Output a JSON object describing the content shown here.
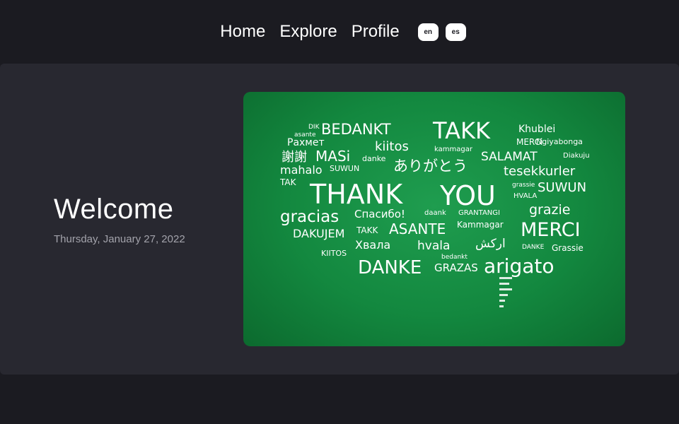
{
  "nav": {
    "links": [
      "Home",
      "Explore",
      "Profile"
    ],
    "languages": [
      "en",
      "es"
    ]
  },
  "main": {
    "title": "Welcome",
    "date": "Thursday, January 27, 2022"
  },
  "hero_image": {
    "alt": "Thank you word cloud on chalkboard",
    "background_color": "#13883f",
    "words": {
      "w1": "DIK",
      "w2": "BEDANKT",
      "w3": "TAKK",
      "w4": "Khublei",
      "w5": "asante",
      "w6": "Рахмет",
      "w7": "kiitos",
      "w8": "MERCi",
      "w9": "Ngiyabonga",
      "w10": "謝謝",
      "w11": "MASi",
      "w12": "kammagar",
      "w13": "SALAMAT",
      "w14": "Diakuju",
      "w15": "mahalo",
      "w16": "SUWUN",
      "w17": "ありがとう",
      "w18": "tesekkurler",
      "w19": "THANK",
      "w20": "YOU",
      "w21": "gracias",
      "w22": "Спасибо!",
      "w23": "daank",
      "w24": "GRANTANGI",
      "w25": "grazie",
      "w26": "DAKUJEM",
      "w27": "ASANTE",
      "w28": "Kammagar",
      "w29": "MERCI",
      "w30": "Хвала",
      "w31": "hvala",
      "w32": "اركش",
      "w33": "Grassie",
      "w34": "DANKE",
      "w35": "GRAZAS",
      "w36": "arigato",
      "w37": "KIITOS",
      "w38": "bedankt",
      "w39": "TAK",
      "w40": "danke",
      "w41": "TAKK",
      "w42": "grassie",
      "w43": "HVALA",
      "w44": "DANKE",
      "w45": "SUWUN"
    }
  }
}
